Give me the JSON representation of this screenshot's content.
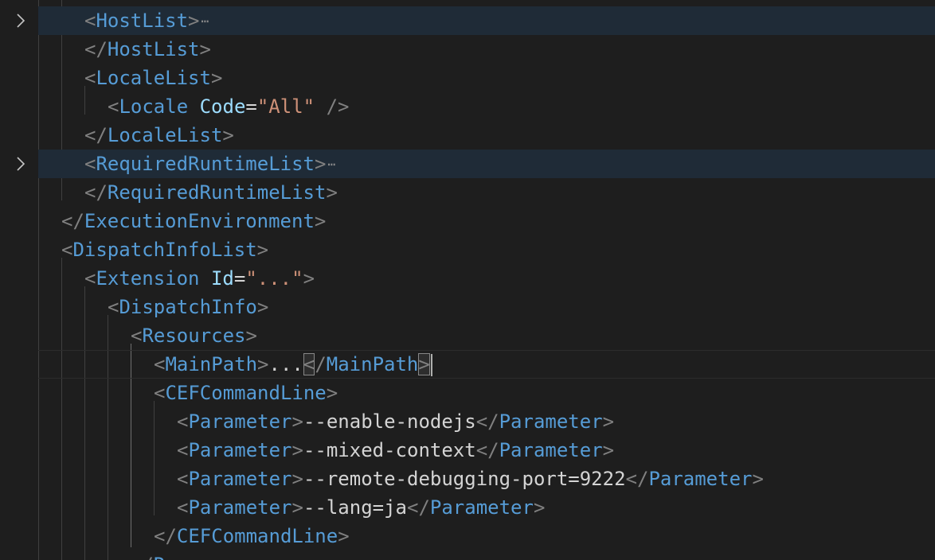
{
  "editor": {
    "lines": [
      {
        "tags": [
          "HostList"
        ],
        "folded": true
      },
      {
        "tags": [
          "HostList"
        ]
      },
      {
        "tags": [
          "LocaleList"
        ]
      },
      {
        "tags": [
          "Locale"
        ],
        "attr_name": "Code",
        "attr_eq": "=",
        "attr_value": "\"All\"",
        "self_close": "/>"
      },
      {
        "tags": [
          "LocaleList"
        ]
      },
      {
        "tags": [
          "RequiredRuntimeList"
        ],
        "folded": true
      },
      {
        "tags": [
          "RequiredRuntimeList"
        ]
      },
      {
        "tags": [
          "ExecutionEnvironment"
        ]
      },
      {
        "tags": [
          "DispatchInfoList"
        ]
      },
      {
        "tags": [
          "Extension"
        ],
        "attr_name": "Id",
        "attr_eq": "=",
        "attr_value": "\"...\""
      },
      {
        "tags": [
          "DispatchInfo"
        ]
      },
      {
        "tags": [
          "Resources"
        ]
      },
      {
        "tags": [
          "MainPath",
          "MainPath"
        ],
        "text": "..."
      },
      {
        "tags": [
          "CEFCommandLine"
        ]
      },
      {
        "tags": [
          "Parameter",
          "Parameter"
        ],
        "text": "--enable-nodejs"
      },
      {
        "tags": [
          "Parameter",
          "Parameter"
        ],
        "text": "--mixed-context"
      },
      {
        "tags": [
          "Parameter",
          "Parameter"
        ],
        "text": "--remote-debugging-port=9222"
      },
      {
        "tags": [
          "Parameter",
          "Parameter"
        ],
        "text": "--lang=ja"
      },
      {
        "tags": [
          "CEFCommandLine"
        ]
      },
      {
        "tags": [
          "Resources"
        ]
      }
    ],
    "folded_ellipsis": "⋯",
    "fold_icon": "chevron-right-icon",
    "colors": {
      "background": "#1e1e1e",
      "tag_bracket": "#808080",
      "tag_name": "#569cd6",
      "attribute_name": "#9cdcfe",
      "attribute_value": "#ce9178",
      "text": "#d4d4d4",
      "folded_line_highlight": "#1f2b37"
    }
  }
}
